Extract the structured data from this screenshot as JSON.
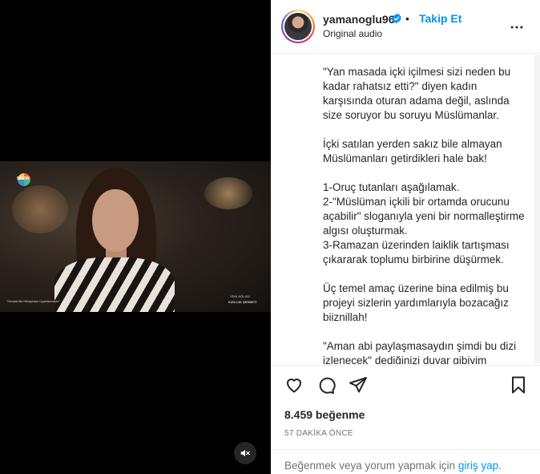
{
  "video": {
    "channel_logo_text": "SHOW",
    "caption_left": "\"Gerçek Bir Hikayeden Uyarlanmıştır\"",
    "caption_right_line1": "YENİ BÖLÜM",
    "caption_right_line2": "KIZILCIK ŞERBETİ",
    "mute_icon": "speaker-muted-icon"
  },
  "post": {
    "username": "yamanoglu96",
    "verified": true,
    "separator": "•",
    "follow_label": "Takip Et",
    "audio": "Original audio",
    "caption": "\"Yan masada içki içilmesi sizi neden bu kadar rahatsız etti?\" diyen kadın karşısında oturan adama değil, aslında size soruyor bu soruyu Müslümanlar.\n\nİçki satılan yerden sakız bile almayan Müslümanları getirdikleri hale bak!\n\n1-Oruç tutanları aşağılamak.\n2-\"Müslüman içkili bir ortamda orucunu açabilir\" sloganıyla yeni bir normalleştirme algısı oluşturmak.\n3-Ramazan üzerinden laiklik tartışması çıkararak toplumu birbirine düşürmek.\n\nÜç temel amaç üzerine bina edilmiş bu projeyi sizlerin yardımlarıyla bozacağız biiznillah!\n\n\"Aman abi paylaşmasaydın şimdi bu dizi izlenecek\" dediğinizi duyar gibiyim",
    "likes": "8.459 beğenme",
    "time": "57 DAKİKA ÖNCE"
  },
  "footer": {
    "prefix": "Beğenmek veya yorum yapmak için",
    "link": "giriş yap",
    "suffix": "."
  },
  "colors": {
    "accent": "#0095f6",
    "text": "#262626",
    "muted": "#737373"
  }
}
